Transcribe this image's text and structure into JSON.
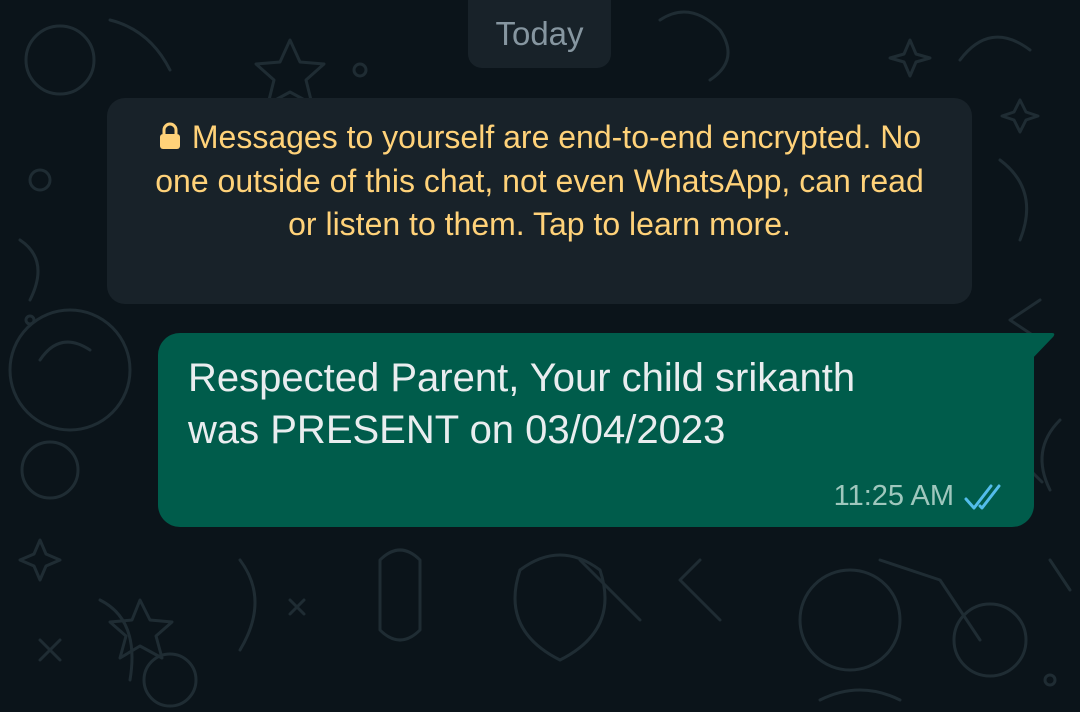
{
  "chat": {
    "date_chip": "Today",
    "encryption_notice": "Messages to yourself are end-to-end encrypted. No one outside of this chat, not even WhatsApp, can read or listen to them. Tap to learn more.",
    "messages": [
      {
        "text": "Respected Parent, Your child srikanth\nwas PRESENT on 03/04/2023",
        "time": "11:25 AM",
        "status_icon": "double-check-read-icon"
      }
    ]
  },
  "icons": {
    "notice": "lock-icon"
  },
  "colors": {
    "background": "#0b141a",
    "system_bubble": "#182229",
    "outgoing_bubble": "#005c4b",
    "notice_text": "#ffd279",
    "message_text": "#e9edef",
    "read_check": "#53bdeb"
  }
}
